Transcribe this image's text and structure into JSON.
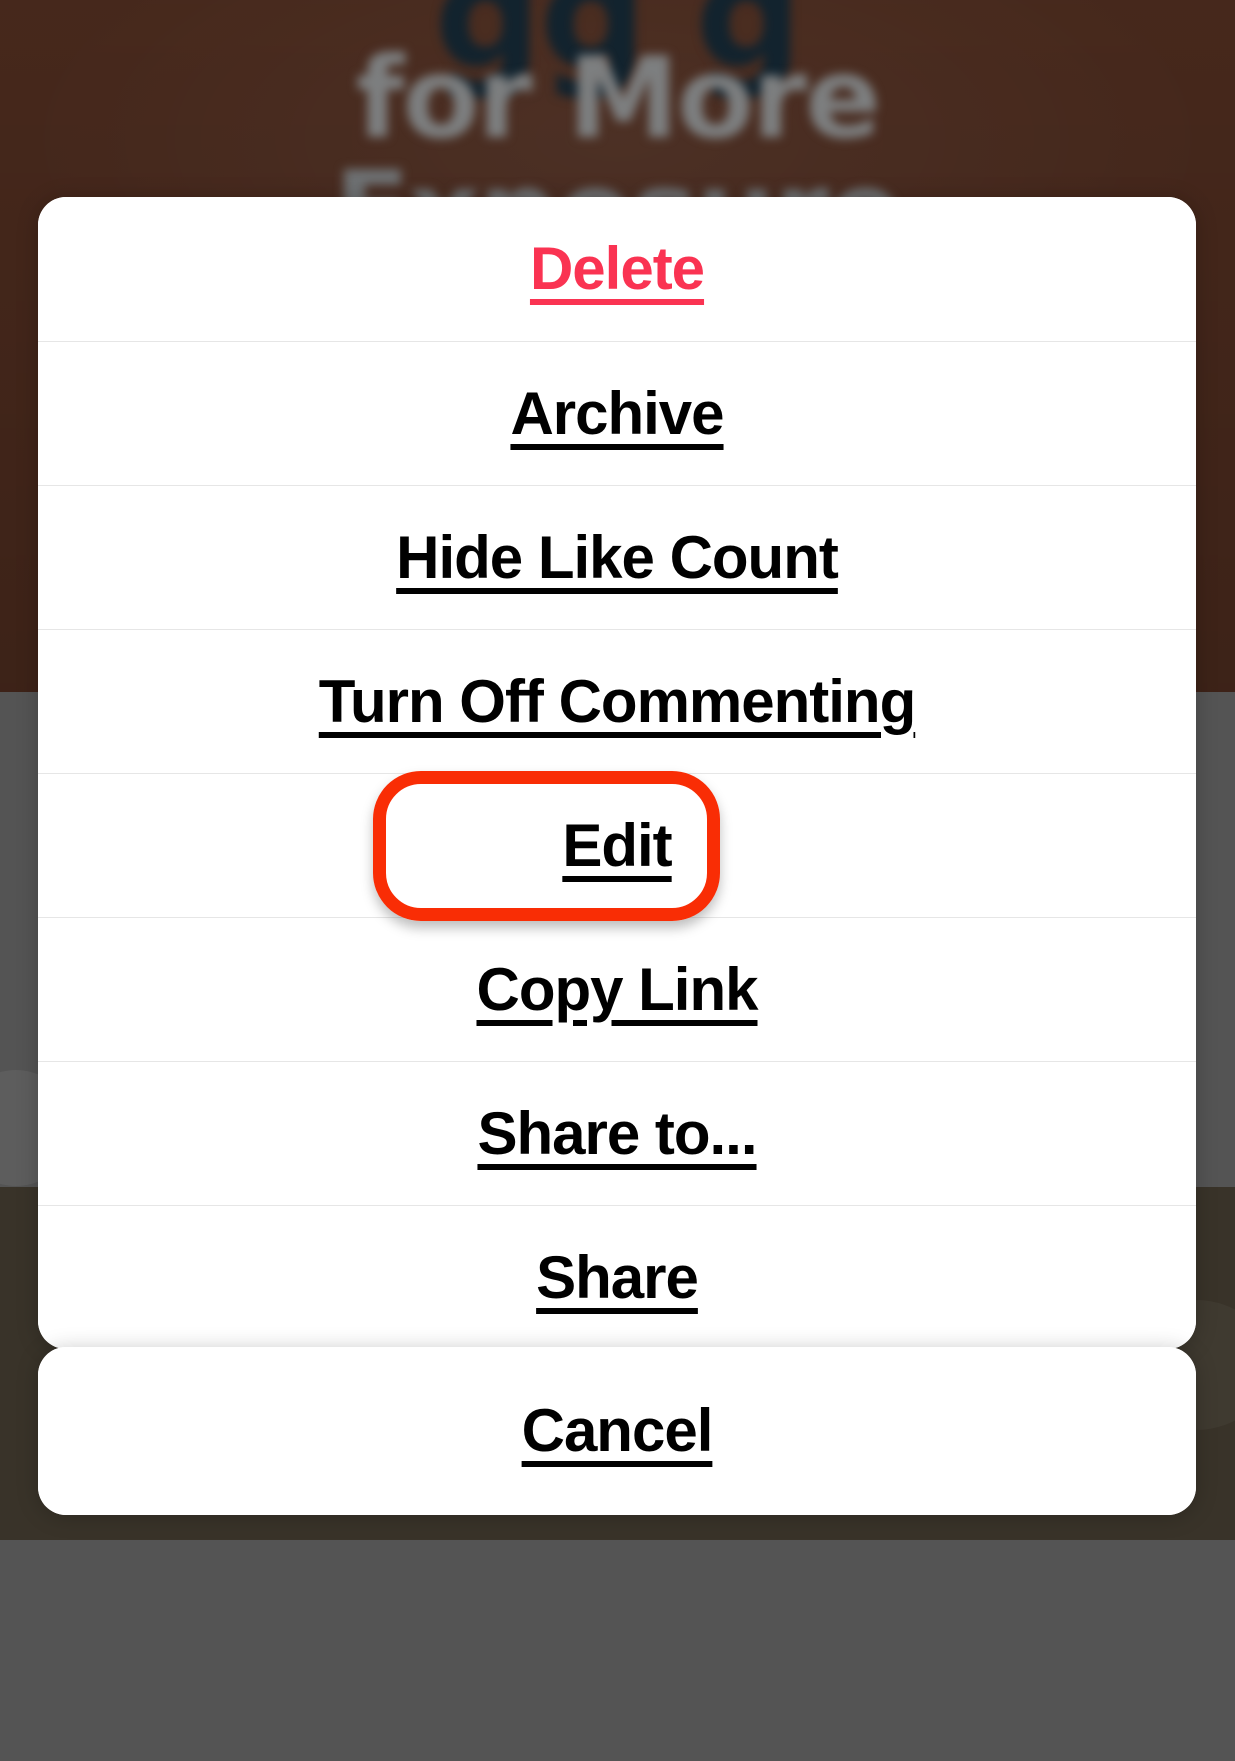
{
  "background": {
    "poster_line_1": "gg  g",
    "poster_line_2": "for More",
    "poster_line_3": "Exposure",
    "brown": "#4a2a1d",
    "gray": "#545454",
    "dark": "#393329"
  },
  "sheet": {
    "items": [
      {
        "label": "Delete",
        "style": "destructive"
      },
      {
        "label": "Archive",
        "style": "default"
      },
      {
        "label": "Hide Like Count",
        "style": "default"
      },
      {
        "label": "Turn Off Commenting",
        "style": "default"
      },
      {
        "label": "Edit",
        "style": "default"
      },
      {
        "label": "Copy Link",
        "style": "default"
      },
      {
        "label": "Share to...",
        "style": "default"
      },
      {
        "label": "Share",
        "style": "default"
      }
    ],
    "cancel_label": "Cancel"
  },
  "annotation": {
    "target": "Edit",
    "color": "#f92d05",
    "shape": "rounded-rectangle"
  },
  "colors": {
    "destructive": "#fa3352",
    "default_text": "#000000",
    "sheet_background": "#ffffff",
    "divider": "#e6e6e6"
  }
}
